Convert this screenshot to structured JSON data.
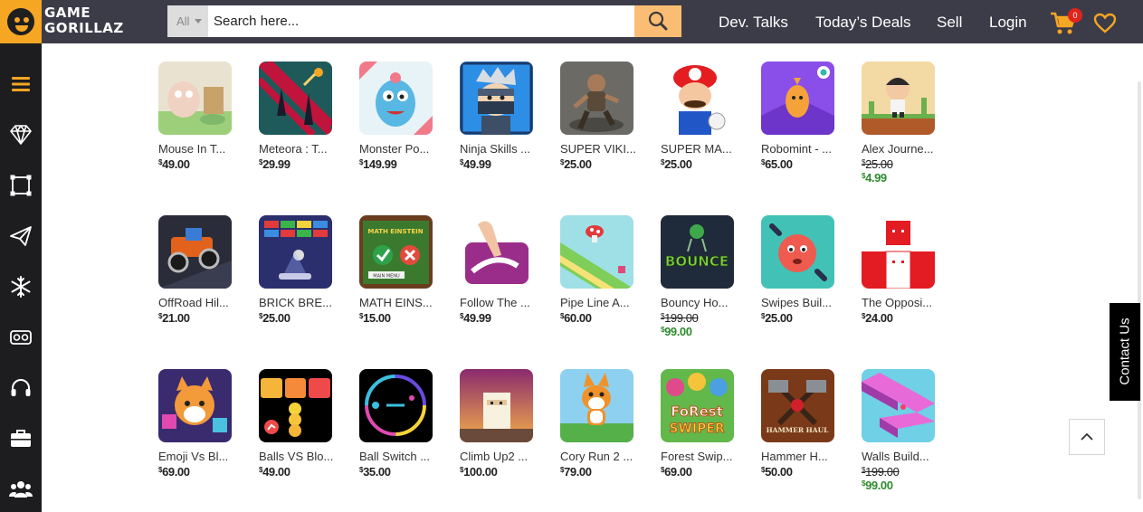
{
  "brand": {
    "line1": "GAME",
    "line2": "GORILLAZ"
  },
  "search": {
    "category": "All",
    "placeholder": "Search here..."
  },
  "nav": {
    "dev_talks": "Dev. Talks",
    "todays_deals": "Today’s Deals",
    "sell": "Sell",
    "login": "Login",
    "cart_count": "0"
  },
  "contact": "Contact Us",
  "sidebar_icons": [
    "menu-icon",
    "diamond-icon",
    "crop-frame-icon",
    "paper-plane-icon",
    "snowflake-icon",
    "vr-headset-icon",
    "headphones-icon",
    "briefcase-icon",
    "users-icon"
  ],
  "colors": {
    "accent": "#f5a623",
    "topbar": "#3c3c48",
    "sidebar": "#1d1d1f",
    "sale": "#2e8b2e"
  },
  "games": [
    {
      "title": "Mouse In T...",
      "price": "49.00"
    },
    {
      "title": "Meteora : T...",
      "price": "29.99"
    },
    {
      "title": "Monster Po...",
      "price": "149.99"
    },
    {
      "title": "Ninja Skills ...",
      "price": "49.99"
    },
    {
      "title": "SUPER VIKI...",
      "price": "25.00"
    },
    {
      "title": "SUPER MA...",
      "price": "25.00"
    },
    {
      "title": "Robomint - ...",
      "price": "65.00"
    },
    {
      "title": "Alex Journe...",
      "old_price": "25.00",
      "sale_price": "4.99"
    },
    {
      "title": "OffRoad Hil...",
      "price": "21.00"
    },
    {
      "title": "BRICK BRE...",
      "price": "25.00"
    },
    {
      "title": "MATH EINS...",
      "price": "15.00"
    },
    {
      "title": "Follow The ...",
      "price": "49.99"
    },
    {
      "title": "Pipe Line A...",
      "price": "60.00"
    },
    {
      "title": "Bouncy Ho...",
      "old_price": "199.00",
      "sale_price": "99.00"
    },
    {
      "title": "Swipes Buil...",
      "price": "25.00"
    },
    {
      "title": "The Opposi...",
      "price": "24.00"
    },
    {
      "title": "Emoji Vs Bl...",
      "price": "69.00"
    },
    {
      "title": "Balls VS Blo...",
      "price": "49.00"
    },
    {
      "title": "Ball Switch ...",
      "price": "35.00"
    },
    {
      "title": "Climb Up2 ...",
      "price": "100.00"
    },
    {
      "title": "Cory Run 2 ...",
      "price": "79.00"
    },
    {
      "title": "Forest Swip...",
      "price": "69.00"
    },
    {
      "title": "Hammer H...",
      "price": "50.00"
    },
    {
      "title": "Walls Build...",
      "old_price": "199.00",
      "sale_price": "99.00"
    }
  ],
  "thumb_text": {
    "bounce": "BOUNCE",
    "forest": "FoRest",
    "swiper": "SWIPER",
    "hammer": "HAMMER HAUL",
    "math": "MATH EINSTEIN",
    "menu": "MAIN MENU"
  }
}
